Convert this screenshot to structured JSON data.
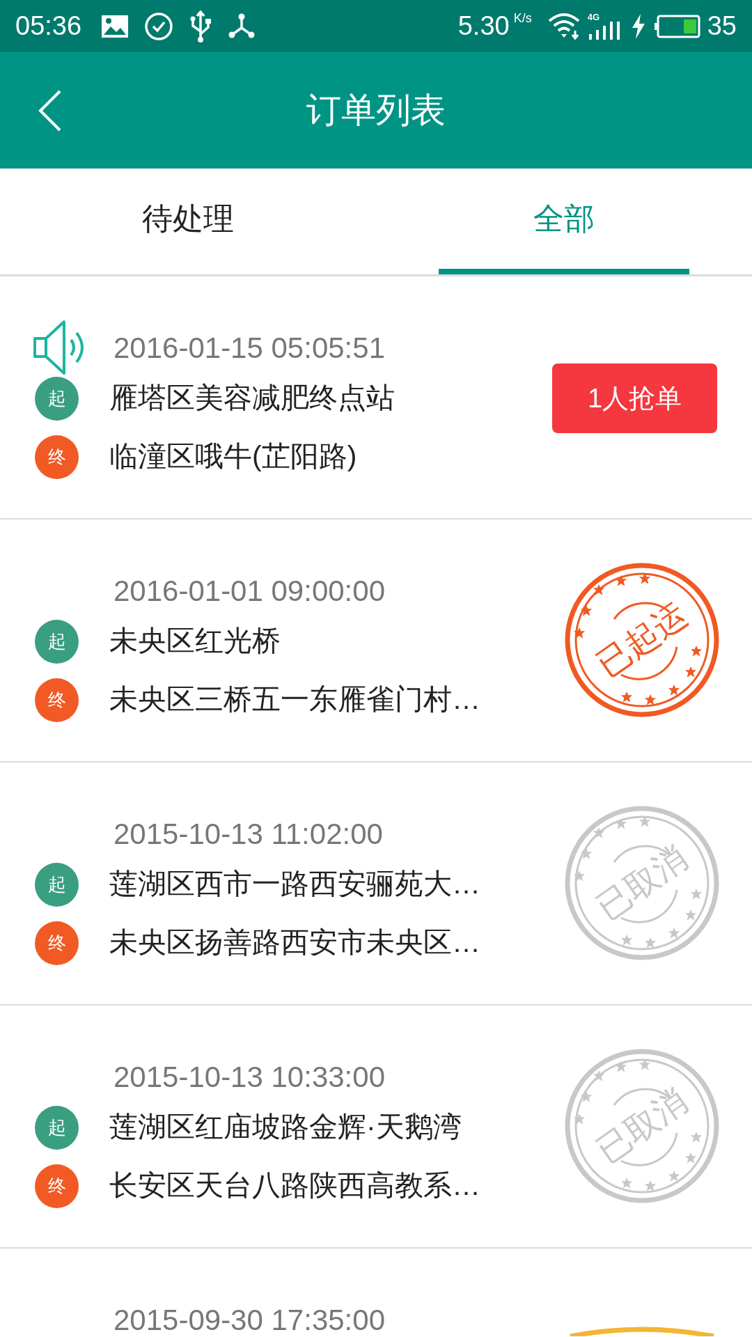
{
  "status_bar": {
    "time": "05:36",
    "speed": "5.30",
    "speed_unit": "K/s",
    "network": "4G",
    "battery": "35"
  },
  "header": {
    "title": "订单列表"
  },
  "tabs": [
    {
      "label": "待处理",
      "selected": false
    },
    {
      "label": "全部",
      "selected": true
    }
  ],
  "orders": [
    {
      "time": "2016-01-15 05:05:51",
      "sound": true,
      "start_mark": "起",
      "start": "雁塔区美容减肥终点站",
      "end_mark": "终",
      "end": "临潼区哦牛(芷阳路)",
      "badge": {
        "kind": "button",
        "label": "1人抢单"
      }
    },
    {
      "time": "2016-01-01 09:00:00",
      "sound": false,
      "start_mark": "起",
      "start": "未央区红光桥",
      "end_mark": "终",
      "end": "未央区三桥五一东雁雀门村…",
      "badge": {
        "kind": "stamp",
        "label": "已起运",
        "color": "#f05a22"
      }
    },
    {
      "time": "2015-10-13 11:02:00",
      "sound": false,
      "start_mark": "起",
      "start": "莲湖区西市一路西安骊苑大…",
      "end_mark": "终",
      "end": "未央区扬善路西安市未央区…",
      "badge": {
        "kind": "stamp",
        "label": "已取消",
        "color": "#c8c8c8"
      }
    },
    {
      "time": "2015-10-13 10:33:00",
      "sound": false,
      "start_mark": "起",
      "start": "莲湖区红庙坡路金辉·天鹅湾",
      "end_mark": "终",
      "end": "长安区天台八路陕西高教系…",
      "badge": {
        "kind": "stamp",
        "label": "已取消",
        "color": "#c8c8c8"
      }
    },
    {
      "time": "2015-09-30 17:35:00",
      "sound": false,
      "badge": {
        "kind": "stamp_edge",
        "color": "#f2b632"
      }
    }
  ]
}
